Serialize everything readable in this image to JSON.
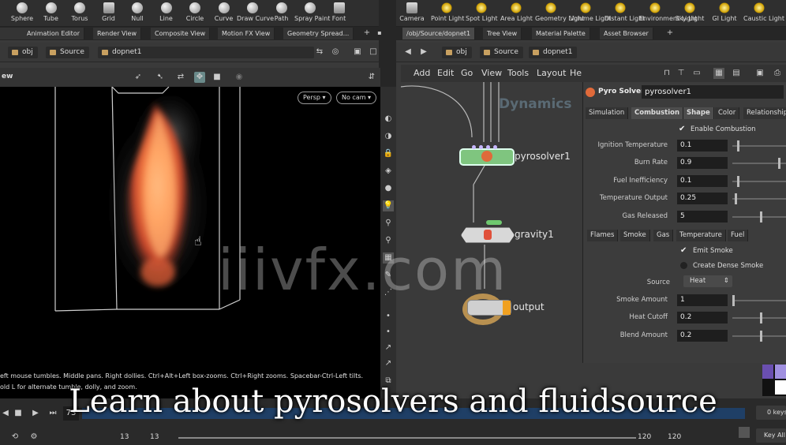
{
  "shelf_left": [
    {
      "label": "Sphere",
      "icon": "sphere-icon"
    },
    {
      "label": "Tube",
      "icon": "tube-icon"
    },
    {
      "label": "Torus",
      "icon": "torus-icon"
    },
    {
      "label": "Grid",
      "icon": "grid-icon"
    },
    {
      "label": "Null",
      "icon": "null-icon"
    },
    {
      "label": "Line",
      "icon": "line-icon"
    },
    {
      "label": "Circle",
      "icon": "circle-icon"
    },
    {
      "label": "Curve",
      "icon": "curve-icon"
    },
    {
      "label": "Draw Curve",
      "icon": "draw-curve-icon"
    },
    {
      "label": "Path",
      "icon": "path-icon"
    },
    {
      "label": "Spray Paint",
      "icon": "spray-paint-icon"
    },
    {
      "label": "Font",
      "icon": "font-icon"
    }
  ],
  "shelf_right": [
    {
      "label": "Camera",
      "icon": "camera-icon"
    },
    {
      "label": "Point Light",
      "icon": "point-light-icon"
    },
    {
      "label": "Spot Light",
      "icon": "spot-light-icon"
    },
    {
      "label": "Area Light",
      "icon": "area-light-icon"
    },
    {
      "label": "Geometry Light",
      "icon": "geometry-light-icon"
    },
    {
      "label": "Volume Light",
      "icon": "volume-light-icon"
    },
    {
      "label": "Distant Light",
      "icon": "distant-light-icon"
    },
    {
      "label": "Environment Light",
      "icon": "environment-light-icon"
    },
    {
      "label": "Sky Light",
      "icon": "sky-light-icon"
    },
    {
      "label": "GI Light",
      "icon": "gi-light-icon"
    },
    {
      "label": "Caustic Light",
      "icon": "caustic-light-icon"
    }
  ],
  "left_tabs": [
    "Animation Editor",
    "Render View",
    "Composite View",
    "Motion FX View",
    "Geometry Spread..."
  ],
  "right_tabs": [
    "/obj/Source/dopnet1",
    "Tree View",
    "Material Palette",
    "Asset Browser"
  ],
  "left_path": {
    "obj": "obj",
    "source": "Source",
    "dopnet": "dopnet1"
  },
  "right_path": {
    "obj": "obj",
    "source": "Source",
    "dopnet": "dopnet1"
  },
  "viewport": {
    "label_fragment": "ew",
    "persp": "Persp",
    "cam": "No cam",
    "hint_line1": "eft mouse tumbles. Middle pans. Right dollies. Ctrl+Alt+Left box-zooms. Ctrl+Right zooms. Spacebar-Ctrl-Left tilts.",
    "hint_line2": "old L for alternate tumble, dolly, and zoom."
  },
  "network": {
    "menu": [
      "Add",
      "Edit",
      "Go",
      "View",
      "Tools",
      "Layout",
      "Help"
    ],
    "context_label": "Dynamics",
    "nodes": {
      "pyro": "pyrosolver1",
      "gravity": "gravity1",
      "output": "output"
    }
  },
  "params": {
    "node_type": "Pyro Solver",
    "node_name": "pyrosolver1",
    "tabs": [
      "Simulation",
      "Combustion",
      "Shape",
      "Color",
      "Relationships"
    ],
    "enable_combustion": "Enable Combustion",
    "rows": [
      {
        "label": "Ignition Temperature",
        "value": "0.1",
        "slider": 0.1
      },
      {
        "label": "Burn Rate",
        "value": "0.9",
        "slider": 0.9
      },
      {
        "label": "Fuel Inefficiency",
        "value": "0.1",
        "slider": 0.1
      },
      {
        "label": "Temperature Output",
        "value": "0.25",
        "slider": 0.05
      },
      {
        "label": "Gas Released",
        "value": "5",
        "slider": 0.55
      }
    ],
    "subtabs": [
      "Flames",
      "Smoke",
      "Gas",
      "Temperature",
      "Fuel"
    ],
    "emit_smoke": "Emit Smoke",
    "dense_smoke": "Create Dense Smoke",
    "source_label": "Source",
    "source_value": "Heat",
    "rows2": [
      {
        "label": "Smoke Amount",
        "value": "1",
        "slider": 0.0
      },
      {
        "label": "Heat Cutoff",
        "value": "0.2",
        "slider": 0.55
      },
      {
        "label": "Blend Amount",
        "value": "0.2",
        "slider": 0.55
      }
    ]
  },
  "timeline": {
    "frame": "73",
    "start": "13",
    "start2": "13",
    "end": "120",
    "end2": "120",
    "keys": "0 keys",
    "key_all": "Key All"
  },
  "caption": "Learn about pyrosolvers and fluidsource",
  "watermark": "iiivfx.com"
}
